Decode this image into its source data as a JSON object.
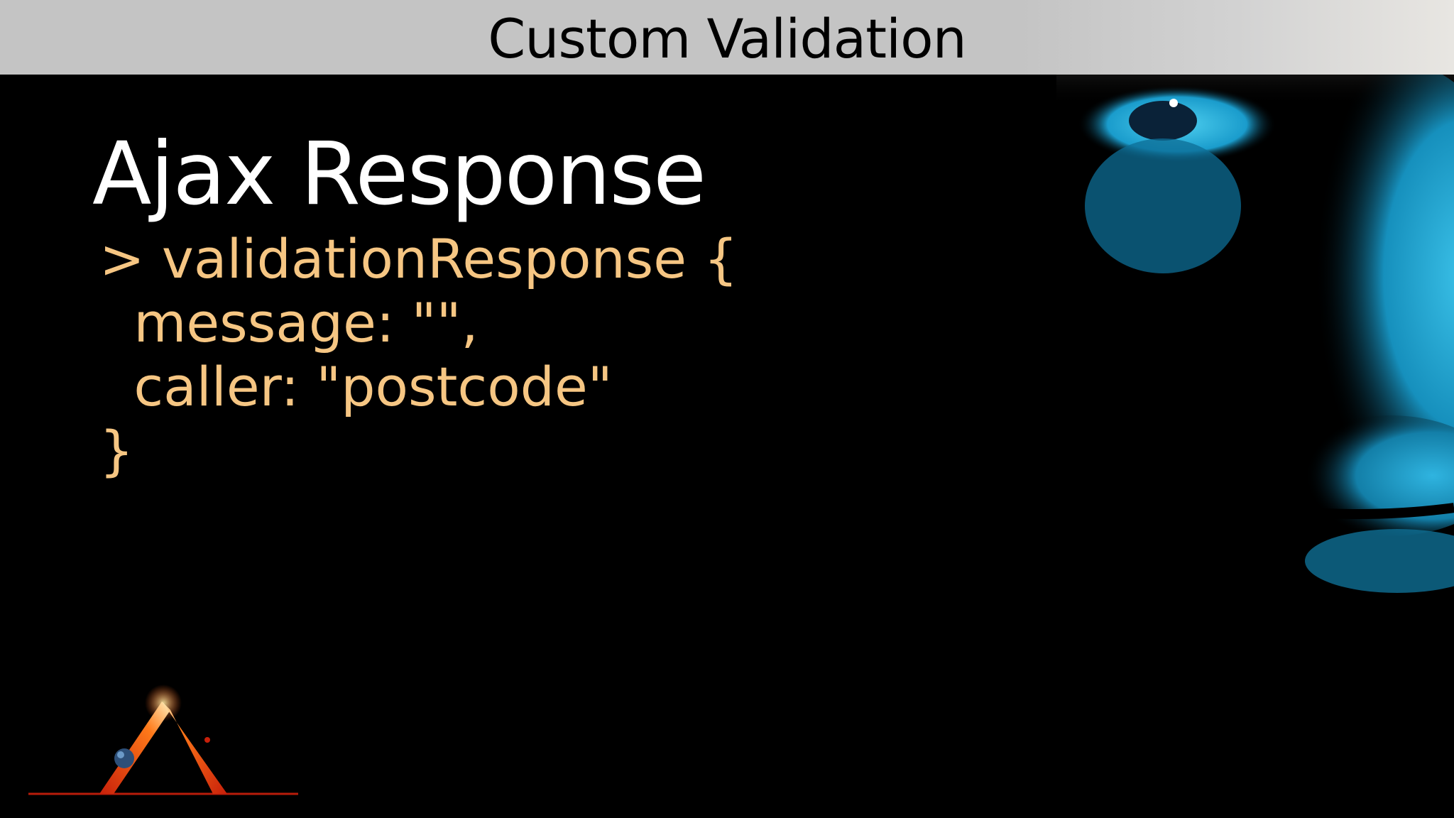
{
  "header": {
    "title": "Custom Validation"
  },
  "slide": {
    "title": "Ajax Response",
    "code_lines": [
      "> validationResponse {",
      "  message: \"\",",
      "  caller: \"postcode\"",
      "}"
    ]
  },
  "colors": {
    "background": "#000000",
    "header_bg": "#c4c4c4",
    "title_text": "#ffffff",
    "code_text": "#f6c683",
    "face_tint": "#1fb3e0"
  },
  "images": {
    "right_photo": "face-eye-portrait",
    "bottom_logo": "pyramid-planet-logo"
  }
}
